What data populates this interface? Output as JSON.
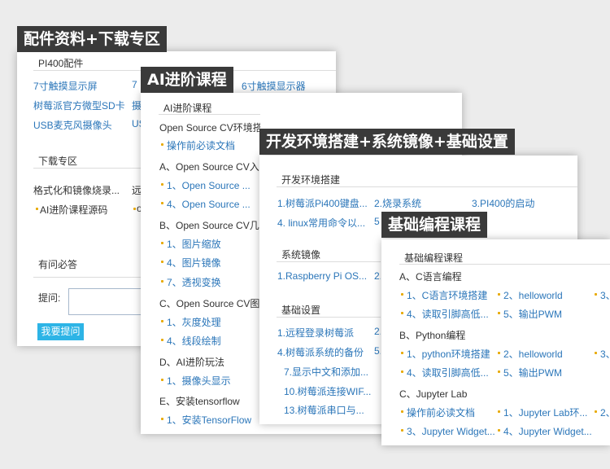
{
  "card1": {
    "banner": "配件资料+下载专区",
    "section_title": "PI400配件",
    "accessories": [
      "7寸触摸显示屏",
      "7",
      "6寸触摸显示器",
      "树莓派官方微型SD卡",
      "摄",
      "USB麦克风摄像头",
      "US"
    ],
    "download_title": "下载专区",
    "downloads": [
      "格式化和镜像烧录...",
      "远",
      "AI进阶课程源码",
      "o"
    ],
    "qa_title": "有问必答",
    "question_label": "提问:",
    "ask_button": "我要提问"
  },
  "card2": {
    "banner": "AI进阶课程",
    "section_title": "AI进阶课程",
    "g1_title": "Open Source CV环境搭建",
    "g1_items": [
      "操作前必读文档"
    ],
    "g2_title": "A、Open Source CV入",
    "g2_items": [
      "1、Open Source ...",
      "4、Open Source ..."
    ],
    "g3_title": "B、Open Source CV几",
    "g3_items": [
      "1、图片缩放",
      "4、图片镜像",
      "7、透视变换"
    ],
    "g4_title": "C、Open Source CV图",
    "g4_items": [
      "1、灰度处理",
      "4、线段绘制"
    ],
    "g5_title": "D、AI进阶玩法",
    "g5_items": [
      "1、摄像头显示"
    ],
    "g6_title": "E、安装tensorflow",
    "g6_items": [
      "1、安装TensorFlow"
    ]
  },
  "card3": {
    "banner": "开发环境搭建+系统镜像+基础设置",
    "env_title": "开发环境搭建",
    "env_items": [
      "1.树莓派Pi400键盘...",
      "2.烧录系统",
      "3.PI400的启动",
      "4. linux常用命令以...",
      "5"
    ],
    "image_title": "系统镜像",
    "image_items": [
      "1.Raspberry Pi OS...",
      "2."
    ],
    "basic_title": "基础设置",
    "basic_items": [
      "1.远程登录树莓派",
      "2.",
      "4.树莓派系统的备份",
      "5.",
      "7.显示中文和添加...",
      "10.树莓派连接WIF...",
      "13.树莓派串口与..."
    ]
  },
  "card4": {
    "banner": "基础编程课程",
    "section_title": "基础编程课程",
    "a_title": "A、C语言编程",
    "a_items": [
      "1、C语言环境搭建",
      "2、helloworld",
      "3、",
      "4、读取引脚高低...",
      "5、输出PWM"
    ],
    "b_title": "B、Python编程",
    "b_items": [
      "1、python环境搭建",
      "2、helloworld",
      "3、",
      "4、读取引脚高低...",
      "5、输出PWM"
    ],
    "c_title": "C、Jupyter Lab",
    "c_items": [
      "操作前必读文档",
      "1、Jupyter Lab环...",
      "2、",
      "3、Jupyter Widget...",
      "4、Jupyter Widget..."
    ]
  }
}
